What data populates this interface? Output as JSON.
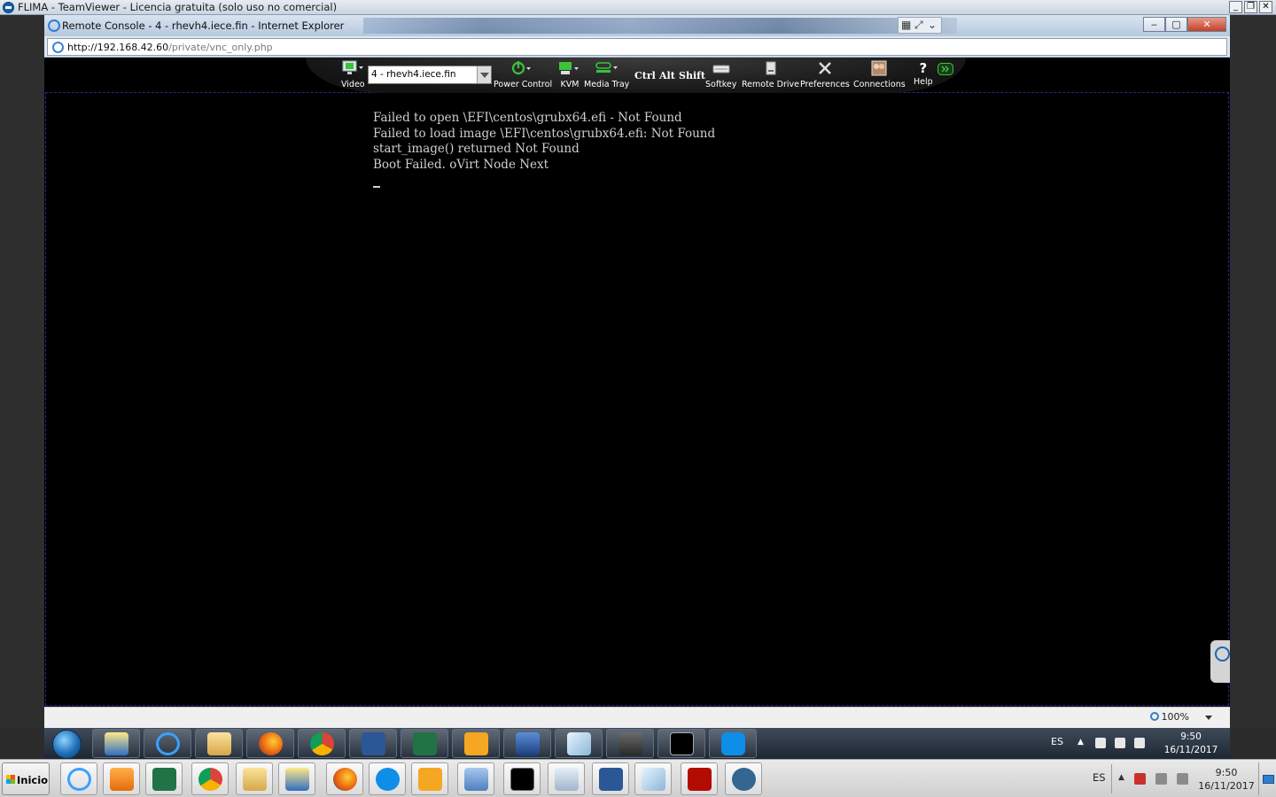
{
  "teamviewer": {
    "title": "FLIMA - TeamViewer - Licencia gratuita (solo uso no comercial)"
  },
  "ie": {
    "title": "Remote Console - 4 - rhevh4.iece.fin - Internet Explorer",
    "url_host": "http://192.168.42.60",
    "url_path": "/private/vnc_only.php",
    "zoom": "100%"
  },
  "kvm_toolbar": {
    "video_label": "Video",
    "host_selected": "4 - rhevh4.iece.fin",
    "power_label": "Power Control",
    "kvm_label": "KVM",
    "media_label": "Media Tray",
    "ctrl_label": "Ctrl",
    "alt_label": "Alt",
    "shift_label": "Shift",
    "softkey_label": "Softkey",
    "remote_drive_label": "Remote Drive",
    "preferences_label": "Preferences",
    "connections_label": "Connections",
    "help_label": "Help",
    "help_glyph": "?",
    "accent_green": "#39c43a"
  },
  "console": {
    "lines": [
      "Failed to open \\EFI\\centos\\grubx64.efi - Not Found",
      "Failed to load image \\EFI\\centos\\grubx64.efi: Not Found",
      "start_image() returned Not Found",
      "Boot Failed. oVirt Node Next"
    ]
  },
  "remote_taskbar": {
    "apps": [
      "network-icon",
      "ie-icon",
      "explorer-icon",
      "firefox-icon",
      "chrome-icon",
      "word-icon",
      "excel-icon",
      "outlook-icon",
      "remote-desktop-icon",
      "eraser-icon",
      "lock-icon",
      "cmd-icon",
      "teamviewer-icon"
    ],
    "lang": "ES",
    "time": "9:50",
    "date": "16/11/2017"
  },
  "local_taskbar": {
    "start_label": "Inicio",
    "apps": [
      "ie-icon",
      "media-player-icon",
      "excel-icon",
      "chrome-icon",
      "explorer-icon",
      "network-icon",
      "firefox-icon",
      "teamviewer-icon",
      "outlook-icon",
      "control-panel-icon",
      "cmd-icon",
      "calculator-icon",
      "word-icon",
      "eraser-icon",
      "pdf-icon",
      "postgres-icon"
    ],
    "lang": "ES",
    "time": "9:50",
    "date": "16/11/2017"
  }
}
